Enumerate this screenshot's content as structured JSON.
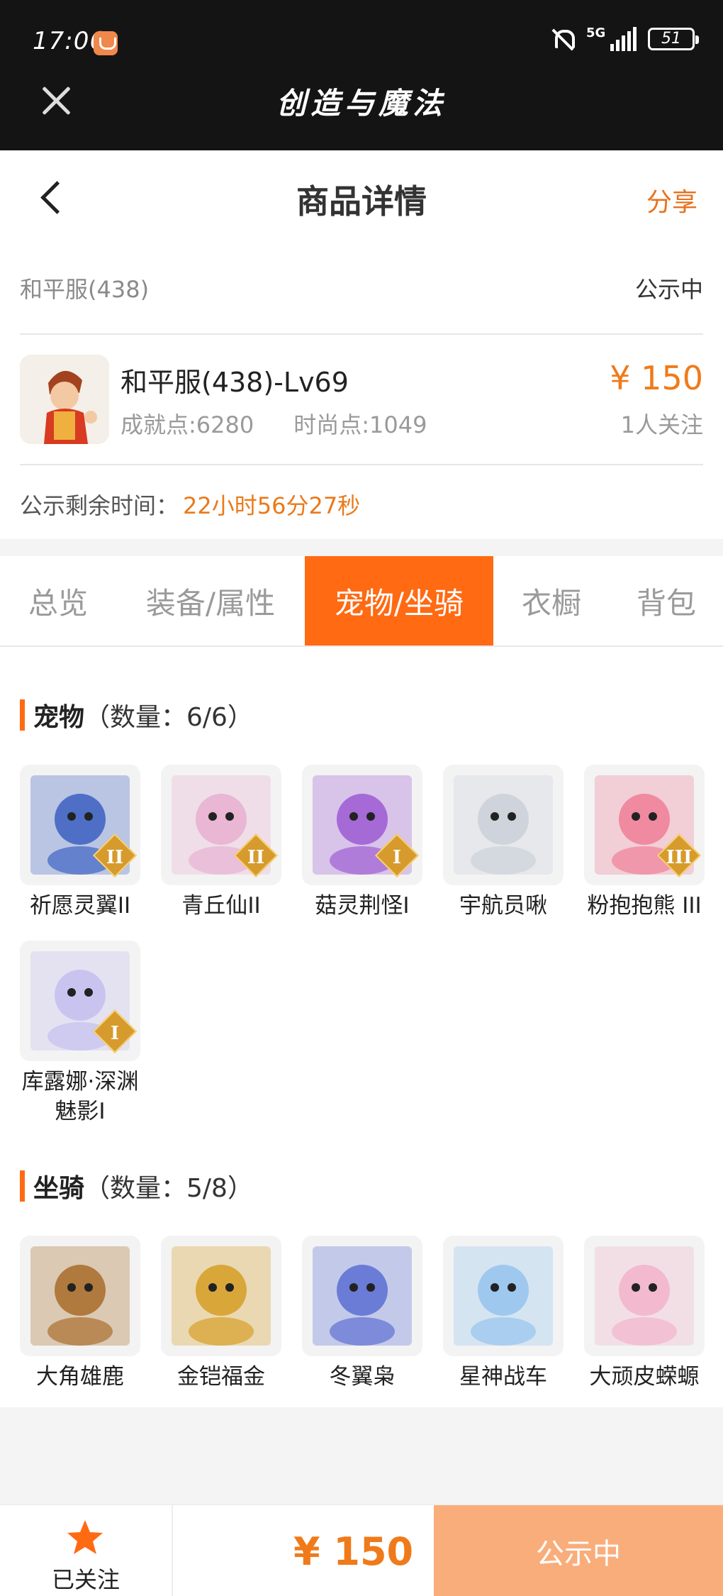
{
  "status_bar": {
    "time": "17:06",
    "network": "5G",
    "battery": "51"
  },
  "app_bar": {
    "title": "创造与魔法"
  },
  "header": {
    "title": "商品详情",
    "share_label": "分享"
  },
  "server": {
    "name": "和平服(438)",
    "status": "公示中"
  },
  "character": {
    "name": "和平服(438)-Lv69",
    "achievement": "成就点:6280",
    "fashion": "时尚点:1049",
    "price": "¥ 150",
    "followers": "1人关注"
  },
  "timer": {
    "label": "公示剩余时间：",
    "value": "22小时56分27秒"
  },
  "tabs": [
    {
      "label": "总览"
    },
    {
      "label": "装备/属性"
    },
    {
      "label": "宠物/坐骑",
      "active": true
    },
    {
      "label": "衣橱"
    },
    {
      "label": "背包"
    }
  ],
  "pets": {
    "title": "宠物",
    "count": "（数量：6/6）",
    "items": [
      {
        "name": "祈愿灵翼II",
        "badge": "II",
        "icon": "bird-creature-icon",
        "color": "#4f6fc7"
      },
      {
        "name": "青丘仙II",
        "badge": "II",
        "icon": "fox-fairy-icon",
        "color": "#e9b6d4"
      },
      {
        "name": "菇灵荆怪I",
        "badge": "I",
        "icon": "mushroom-sprite-icon",
        "color": "#a66ad6"
      },
      {
        "name": "宇航员啾",
        "badge": "",
        "icon": "astronaut-icon",
        "color": "#cfd3dc"
      },
      {
        "name": "粉抱抱熊 III",
        "badge": "III",
        "icon": "pink-bear-icon",
        "color": "#f08aa0"
      },
      {
        "name": "库露娜·深渊魅影I",
        "badge": "I",
        "icon": "abyss-phantom-icon",
        "color": "#c9c4ef"
      }
    ]
  },
  "mounts": {
    "title": "坐骑",
    "count": "（数量：5/8）",
    "items": [
      {
        "name": "大角雄鹿",
        "icon": "stag-icon",
        "color": "#b07a3e"
      },
      {
        "name": "金铠福金",
        "icon": "golden-armor-icon",
        "color": "#d9a63a"
      },
      {
        "name": "冬翼枭",
        "icon": "winter-owl-icon",
        "color": "#6b7cd6"
      },
      {
        "name": "星神战车",
        "icon": "star-horse-icon",
        "color": "#9fc8ef"
      },
      {
        "name": "大顽皮蝾螈",
        "icon": "axolotl-icon",
        "color": "#f2b9cf"
      }
    ]
  },
  "bottom_bar": {
    "follow_label": "已关注",
    "price": "¥ 150",
    "status_label": "公示中"
  }
}
